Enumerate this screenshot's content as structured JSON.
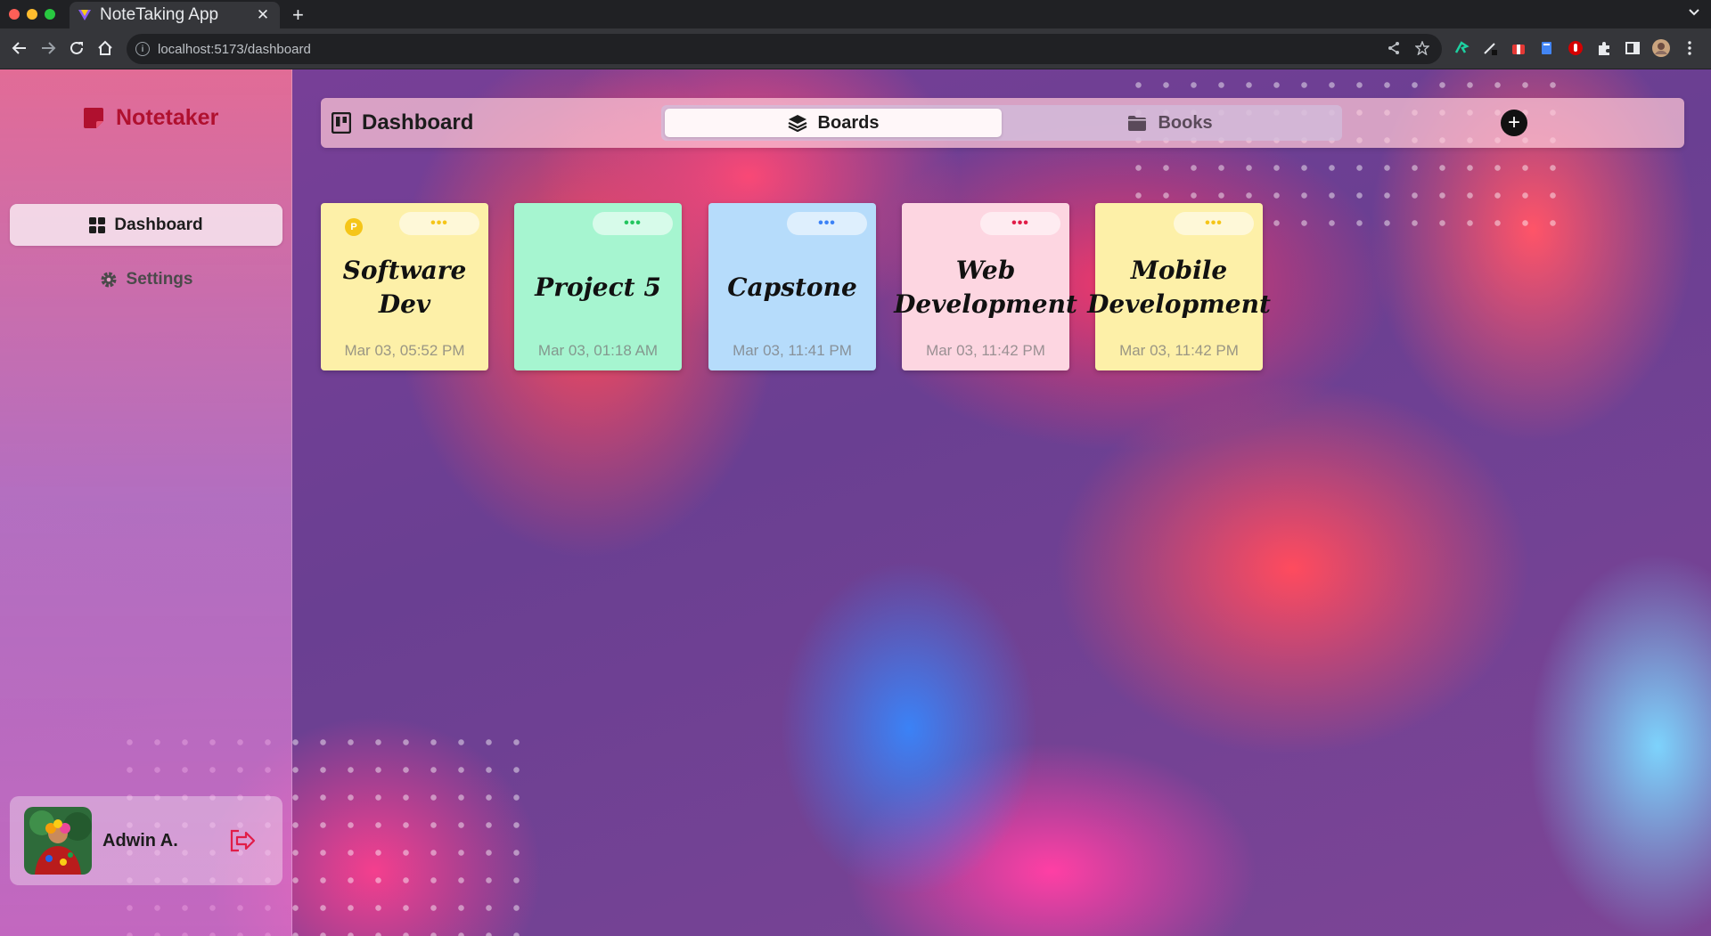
{
  "browser": {
    "tab_title": "NoteTaking App",
    "tab_close": "✕",
    "new_tab": "+",
    "url": "localhost:5173/dashboard"
  },
  "app": {
    "brand": "Notetaker",
    "nav": [
      {
        "label": "Dashboard",
        "icon": "grid-icon",
        "active": true
      },
      {
        "label": "Settings",
        "icon": "gear-icon",
        "active": false
      }
    ],
    "user": {
      "name": "Adwin A."
    },
    "header": {
      "title": "Dashboard",
      "tabs": [
        {
          "label": "Boards",
          "icon": "layers-icon",
          "active": true
        },
        {
          "label": "Books",
          "icon": "folder-icon",
          "active": false
        }
      ],
      "add_label": "+"
    },
    "boards": [
      {
        "title": "Software Dev",
        "date": "Mar 03, 05:52 PM",
        "color": "#fdf0a8",
        "dot_color": "#f5c518",
        "badge": "P"
      },
      {
        "title": "Project 5",
        "date": "Mar 03, 01:18 AM",
        "color": "#a6f5d0",
        "dot_color": "#22c55e"
      },
      {
        "title": "Capstone",
        "date": "Mar 03, 11:41 PM",
        "color": "#b6dcfb",
        "dot_color": "#3b82f6"
      },
      {
        "title": "Web Development",
        "date": "Mar 03, 11:42 PM",
        "color": "#fdd6e1",
        "dot_color": "#e11d48"
      },
      {
        "title": "Mobile Development",
        "date": "Mar 03, 11:42 PM",
        "color": "#fdf0a8",
        "dot_color": "#f5c518"
      }
    ],
    "menu_dots": "•••"
  }
}
